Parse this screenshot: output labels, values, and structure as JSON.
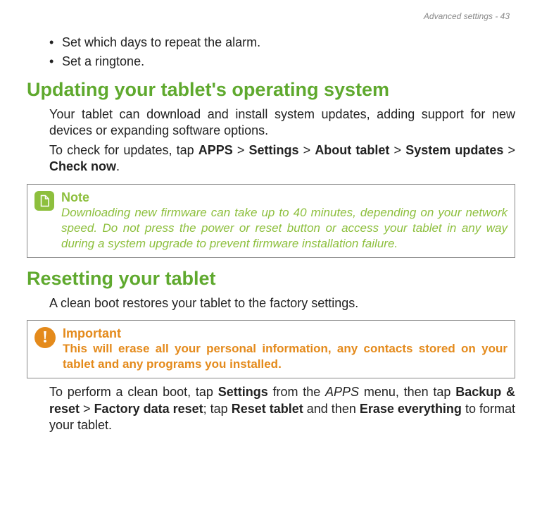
{
  "header": {
    "running": "Advanced settings - 43"
  },
  "bullets": {
    "item1": "Set which days to repeat the alarm.",
    "item2": "Set a ringtone."
  },
  "sec1": {
    "heading": "Updating your tablet's operating system",
    "p1": "Your tablet can download and install system updates, adding support for new devices or expanding software options.",
    "p2a": "To check for updates, tap ",
    "p2_apps": "APPS",
    "p2_gt1": " > ",
    "p2_settings": "Settings",
    "p2_gt2": " > ",
    "p2_about": "About tablet",
    "p2_gt3": " > ",
    "p2_sysupd": "System updates",
    "p2_gt4": " > ",
    "p2_check": "Check now",
    "p2_end": "."
  },
  "note": {
    "title": "Note",
    "text": "Downloading new firmware can take up to 40 minutes, depending on your network speed. Do not press the power or reset button or access your tablet in any way during a system upgrade to prevent firmware installation failure."
  },
  "sec2": {
    "heading": "Resetting your tablet",
    "p1": "A clean boot restores your tablet to the factory settings."
  },
  "important": {
    "title": "Important",
    "text": "This will erase all your personal information, any contacts stored on your tablet and any programs you installed."
  },
  "sec3": {
    "p_a": "To perform a clean boot, tap ",
    "p_settings": "Settings",
    "p_b": " from the ",
    "p_apps_it": "APPS",
    "p_c": " menu, then tap ",
    "p_backup": "Backup & reset",
    "p_gt": " > ",
    "p_factory": "Factory data reset",
    "p_d": "; tap ",
    "p_reset": "Reset tablet",
    "p_e": " and then ",
    "p_erase": "Erase everything",
    "p_f": " to format your tablet."
  }
}
